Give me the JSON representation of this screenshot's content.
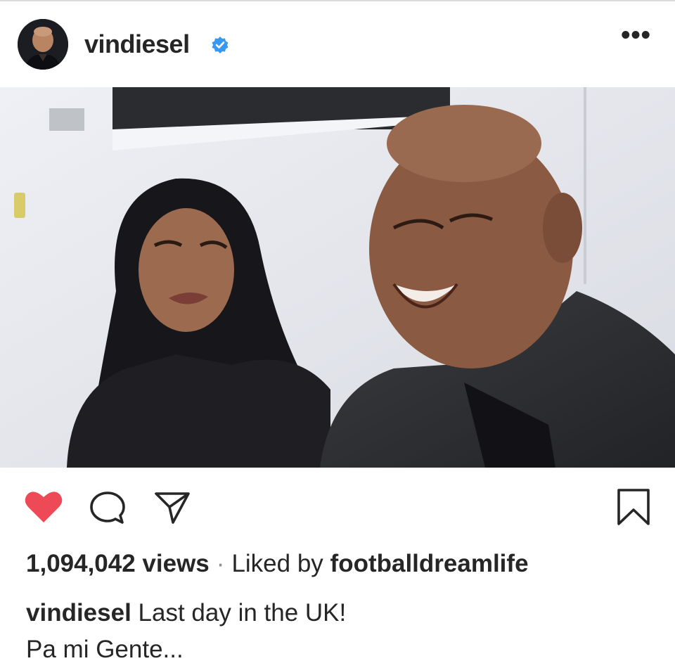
{
  "post": {
    "username": "vindiesel",
    "views": "1,094,042 views",
    "separator": "·",
    "liked_by_prefix": "Liked by",
    "liked_by_user": "footballdreamlife",
    "caption_user": "vindiesel",
    "caption_line1": "Last day in the UK!",
    "caption_line2": "Pa mi Gente...",
    "more_label": "•••"
  },
  "icons": {
    "verified": "verified-badge-icon",
    "more": "more-options-icon",
    "like": "heart-icon",
    "comment": "comment-icon",
    "share": "send-icon",
    "save": "bookmark-icon"
  },
  "colors": {
    "like_active": "#ed4956",
    "verified": "#3897f0",
    "text": "#262626",
    "muted": "#8e8e8e"
  }
}
